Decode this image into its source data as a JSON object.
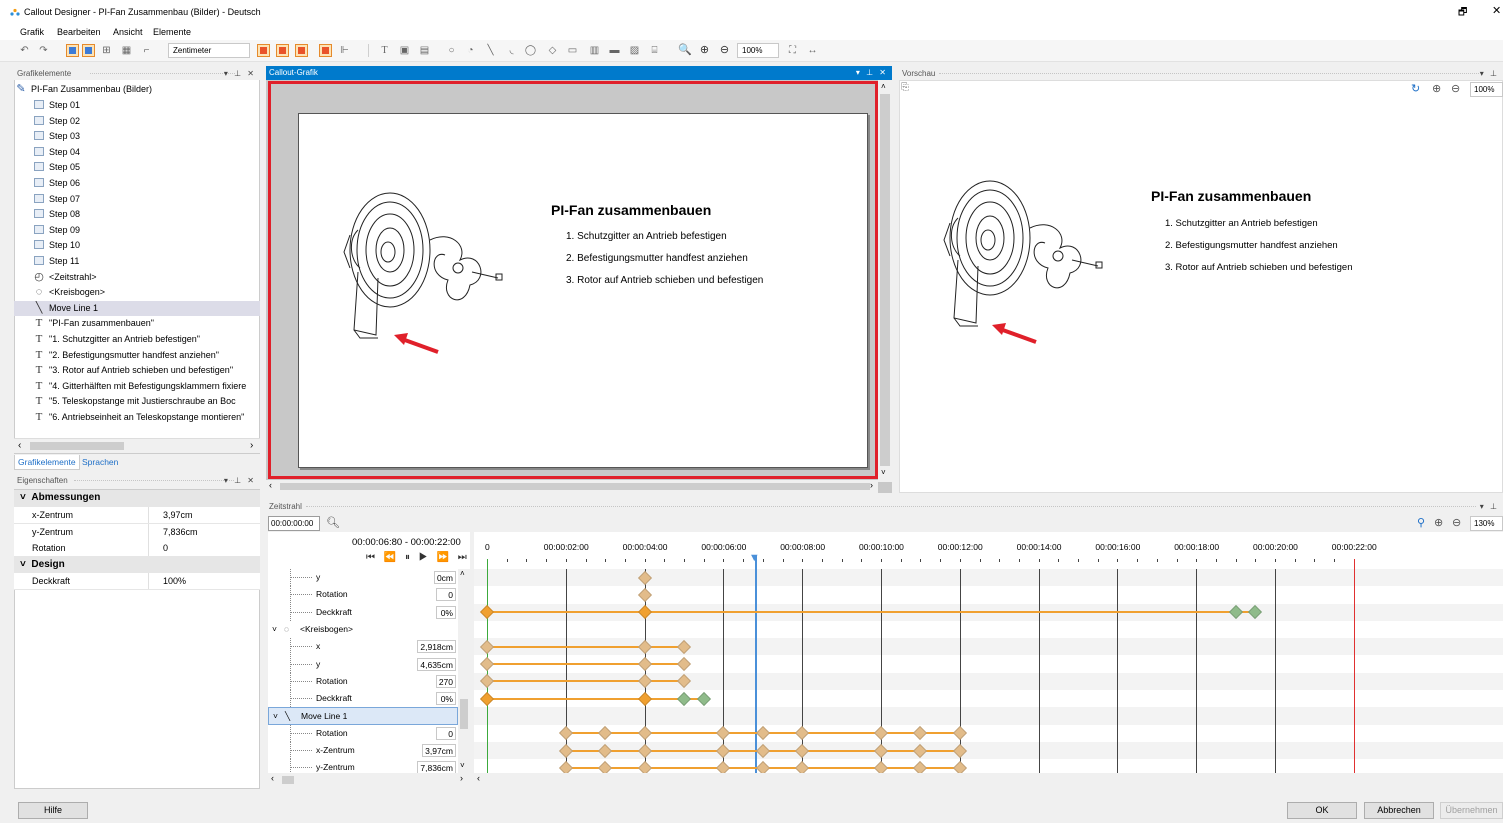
{
  "window": {
    "title": "Callout Designer - PI-Fan Zusammenbau (Bilder) - Deutsch",
    "controls": [
      "—",
      "🗗",
      "✕"
    ]
  },
  "menu": [
    "Grafik",
    "Bearbeiten",
    "Ansicht",
    "Elemente"
  ],
  "toolbar": {
    "unit": "Zentimeter",
    "zoom": "100%"
  },
  "grafikelemente": {
    "title": "Grafikelemente",
    "root": "PI-Fan Zusammenbau (Bilder)",
    "items": [
      "Step 01",
      "Step 02",
      "Step 03",
      "Step 04",
      "Step 05",
      "Step 06",
      "Step 07",
      "Step 08",
      "Step 09",
      "Step 10",
      "Step 11",
      "<Zeitstrahl>",
      "<Kreisbogen>",
      "Move Line 1",
      "\"PI-Fan zusammenbauen\"",
      "\"1. Schutzgitter an Antrieb befestigen\"",
      "\"2. Befestigungsmutter handfest anziehen\"",
      "\"3. Rotor auf Antrieb schieben und befestigen\"",
      "\"4. Gitterhälften mit Befestigungsklammern fixiere",
      "\"5. Teleskopstange mit Justierschraube an    Boc",
      "\"6. Antriebseinheit an Teleskopstange montieren\""
    ],
    "tabs": [
      "Grafikelemente",
      "Sprachen"
    ]
  },
  "eigenschaften": {
    "title": "Eigenschaften",
    "cat1": "Abmessungen",
    "rows1": [
      {
        "k": "x-Zentrum",
        "v": "3,97cm"
      },
      {
        "k": "y-Zentrum",
        "v": "7,836cm"
      },
      {
        "k": "Rotation",
        "v": "0"
      }
    ],
    "cat2": "Design",
    "rows2": [
      {
        "k": "Deckkraft",
        "v": "100%"
      }
    ]
  },
  "callout": {
    "title": "Callout-Grafik",
    "heading": "PI-Fan zusammenbauen",
    "steps": [
      "1. Schutzgitter an Antrieb befestigen",
      "2. Befestigungsmutter handfest anziehen",
      "3. Rotor auf Antrieb schieben und befestigen"
    ]
  },
  "vorschau": {
    "title": "Vorschau",
    "zoom": "100%"
  },
  "zeitstrahl": {
    "title": "Zeitstrahl",
    "time": "00:00:00:00",
    "range": "00:00:06:80  -  00:00:22:00",
    "zoom": "130%",
    "ticks": [
      "0",
      "00:00:02:00",
      "00:00:04:00",
      "00:00:06:00",
      "00:00:08:00",
      "00:00:10:00",
      "00:00:12:00",
      "00:00:14:00",
      "00:00:16:00",
      "00:00:18:00",
      "00:00:20:00",
      "00:00:22:00"
    ],
    "rows": [
      {
        "label": "y",
        "value": "0cm"
      },
      {
        "label": "Rotation",
        "value": "0"
      },
      {
        "label": "Deckkraft",
        "value": "0%"
      },
      {
        "label": "<Kreisbogen>",
        "value": ""
      },
      {
        "label": "x",
        "value": "2,918cm"
      },
      {
        "label": "y",
        "value": "4,635cm"
      },
      {
        "label": "Rotation",
        "value": "270"
      },
      {
        "label": "Deckkraft",
        "value": "0%"
      },
      {
        "label": "Move Line 1",
        "value": ""
      },
      {
        "label": "Rotation",
        "value": "0"
      },
      {
        "label": "x-Zentrum",
        "value": "3,97cm"
      },
      {
        "label": "y-Zentrum",
        "value": "7,836cm"
      }
    ]
  },
  "buttons": {
    "help": "Hilfe",
    "ok": "OK",
    "cancel": "Abbrechen",
    "apply": "Übernehmen"
  },
  "colors": {
    "accent": "#007acc",
    "selection": "#e0202a",
    "key_orange": "#f0a030",
    "key_tan": "#e2bc8a",
    "key_green": "#8fbb8a"
  }
}
